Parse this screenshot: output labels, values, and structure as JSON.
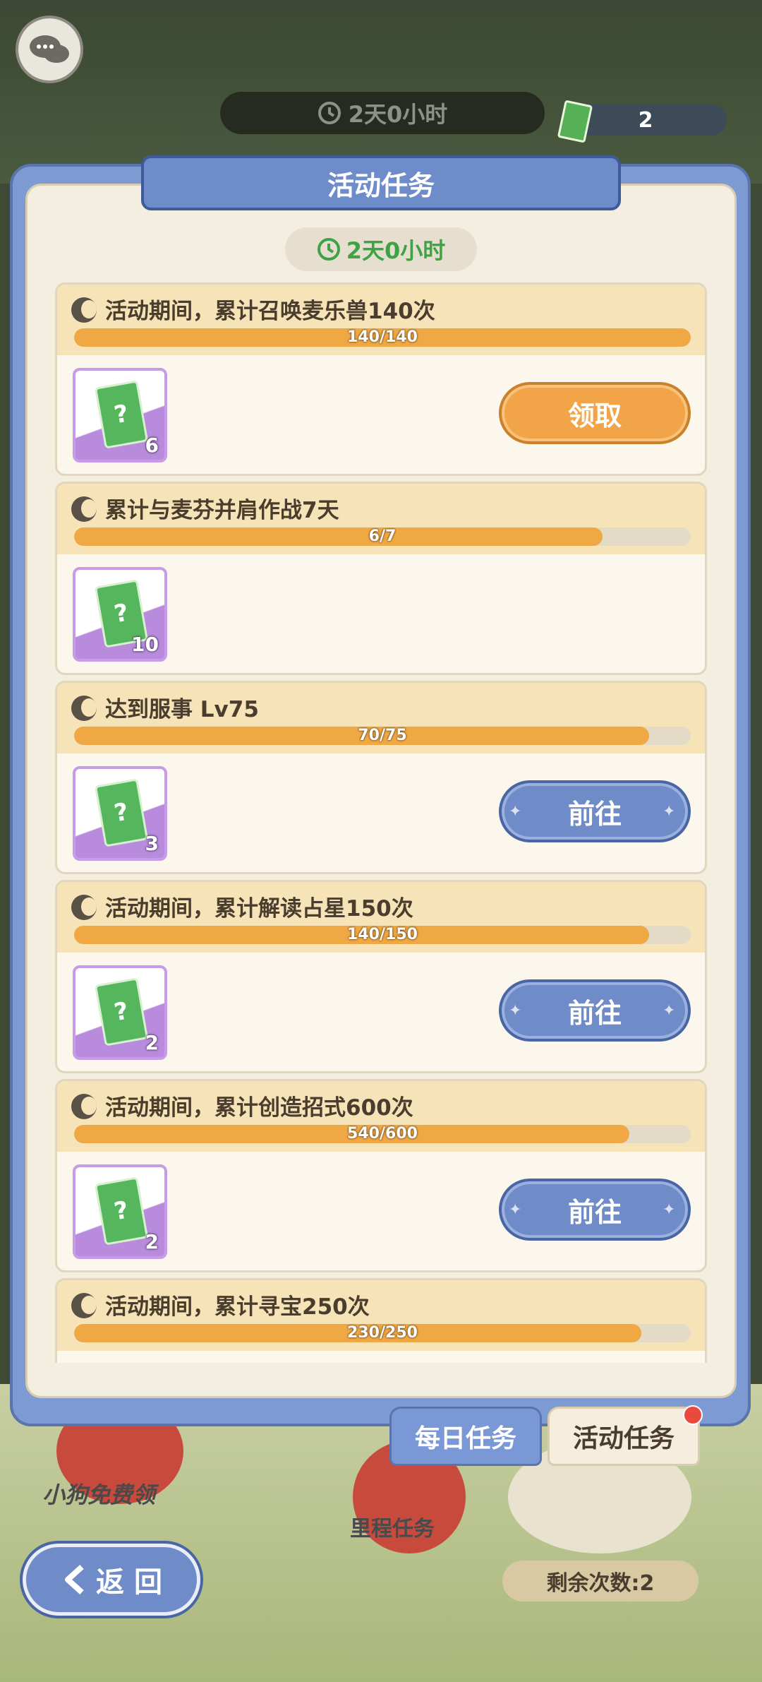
{
  "top": {
    "timer": "2天0小时",
    "ticket_count": "2"
  },
  "panel": {
    "title": "活动任务",
    "timer": "2天0小时"
  },
  "quests": [
    {
      "title": "活动期间，累计召唤麦乐兽140次",
      "progress_text": "140/140",
      "progress": 1.0,
      "reward_count": "6",
      "button": "领取",
      "button_type": "claim"
    },
    {
      "title": "累计与麦芬并肩作战7天",
      "progress_text": "6/7",
      "progress": 0.857,
      "reward_count": "10",
      "button": null,
      "button_type": "none"
    },
    {
      "title": "达到服事 Lv75",
      "progress_text": "70/75",
      "progress": 0.933,
      "reward_count": "3",
      "button": "前往",
      "button_type": "go"
    },
    {
      "title": "活动期间，累计解读占星150次",
      "progress_text": "140/150",
      "progress": 0.933,
      "reward_count": "2",
      "button": "前往",
      "button_type": "go"
    },
    {
      "title": "活动期间，累计创造招式600次",
      "progress_text": "540/600",
      "progress": 0.9,
      "reward_count": "2",
      "button": "前往",
      "button_type": "go"
    },
    {
      "title": "活动期间，累计寻宝250次",
      "progress_text": "230/250",
      "progress": 0.92,
      "reward_count": "",
      "button": null,
      "button_type": "none"
    }
  ],
  "tabs": {
    "daily": "每日任务",
    "event": "活动任务"
  },
  "background": {
    "label_free": "小狗免费领",
    "label_milestone": "里程任务",
    "remaining": "剩余次数:2"
  },
  "back_button": "返 回",
  "colors": {
    "accent_blue": "#6f8bc8",
    "accent_orange": "#f2a548",
    "progress_fill": "#f0a845",
    "timer_green": "#3fa345"
  }
}
